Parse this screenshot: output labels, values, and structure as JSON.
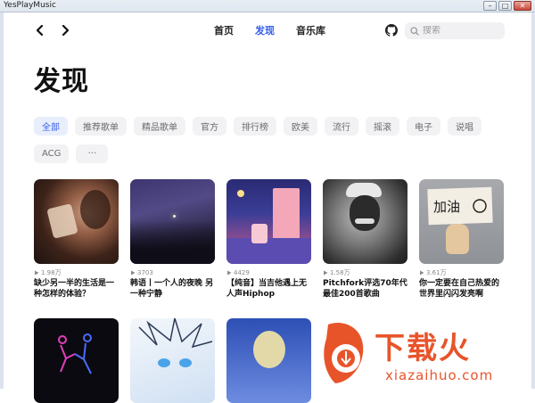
{
  "window": {
    "title": "YesPlayMusic"
  },
  "nav": {
    "tabs": [
      {
        "label": "首页",
        "active": false
      },
      {
        "label": "发现",
        "active": true
      },
      {
        "label": "音乐库",
        "active": false
      }
    ],
    "search_placeholder": "搜索"
  },
  "page": {
    "title": "发现"
  },
  "categories": [
    {
      "label": "全部",
      "active": true
    },
    {
      "label": "推荐歌单"
    },
    {
      "label": "精品歌单"
    },
    {
      "label": "官方"
    },
    {
      "label": "排行榜"
    },
    {
      "label": "欧美"
    },
    {
      "label": "流行"
    },
    {
      "label": "摇滚"
    },
    {
      "label": "电子"
    },
    {
      "label": "说唱"
    },
    {
      "label": "ACG"
    },
    {
      "label": "···"
    }
  ],
  "playlists": [
    {
      "plays": "1.98万",
      "title": "缺少另一半的生活是一种怎样的体验？"
    },
    {
      "plays": "3703",
      "title": "韩语丨一个人的夜晚 另一种宁静"
    },
    {
      "plays": "4429",
      "title": "【纯音】当吉他遇上无人声Hiphop"
    },
    {
      "plays": "1.58万",
      "title": "Pitchfork评选70年代最佳200首歌曲"
    },
    {
      "plays": "3.61万",
      "title": "你一定要在自己热爱的世界里闪闪发亮啊"
    }
  ],
  "watermark": {
    "main": "下载火",
    "sub": "xiazaihuo.com"
  },
  "colors": {
    "accent": "#335eea",
    "watermark": "#e8542a"
  }
}
